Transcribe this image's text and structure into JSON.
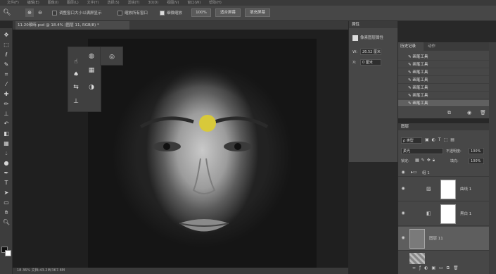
{
  "menu": [
    "文件(F)",
    "编辑(E)",
    "图像(I)",
    "图层(L)",
    "文字(Y)",
    "选择(S)",
    "滤镜(T)",
    "3D(D)",
    "视图(V)",
    "窗口(W)",
    "帮助(H)"
  ],
  "options": {
    "resize_windows_label": "调整窗口大小以满屏显示",
    "zoom_all_label": "缩放所有窗口",
    "scrubby_zoom_label": "细微缩放",
    "zoom_value": "100%",
    "fit_screen_label": "适合屏幕",
    "fill_screen_label": "填充屏幕"
  },
  "document_tab": "11.20頓時.psd @ 18.4% (图层 11, RGB/8) *",
  "status": "18.36%   文档:43.2M/367.8M",
  "properties": {
    "title": "属性",
    "subtitle": "像素图层属性",
    "w_label": "W:",
    "w_value": "26.52 厘米",
    "x_label": "X:",
    "x_value": "0 厘米"
  },
  "history": {
    "tab_active": "历史记录",
    "tab_other": "动作",
    "items": [
      "画笔工具",
      "画笔工具",
      "画笔工具",
      "画笔工具",
      "画笔工具",
      "画笔工具",
      "画笔工具"
    ]
  },
  "layers": {
    "title": "图层",
    "kind": "ρ 类型",
    "blend": "柔光",
    "opacity_label": "不透明度:",
    "opacity_value": "100%",
    "lock_label": "锁定:",
    "fill_label": "填充:",
    "fill_value": "100%",
    "group_name": "组 1",
    "rows": [
      {
        "name": "曲线 1"
      },
      {
        "name": "黑白 1"
      },
      {
        "name": "图层 11"
      }
    ]
  },
  "colors": {
    "accent_dot": "#d8c93a"
  }
}
